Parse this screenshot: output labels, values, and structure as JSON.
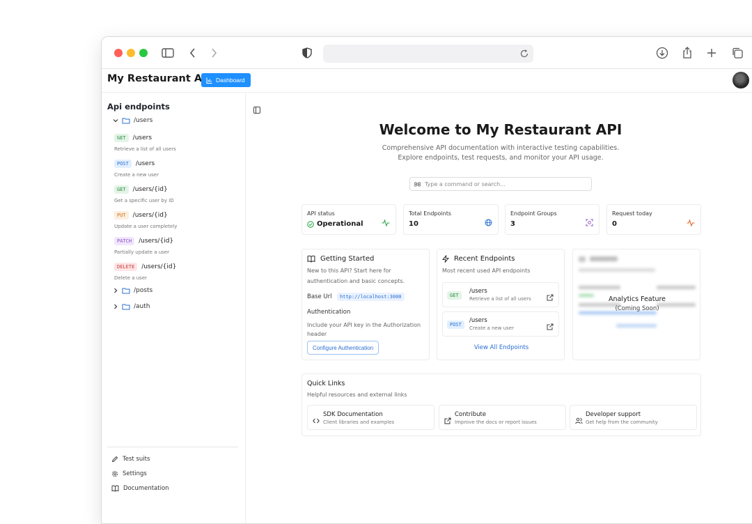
{
  "app": {
    "title": "My Restaurant API",
    "dashboard_label": "Dashboard"
  },
  "sidebar": {
    "title": "Api endpoints",
    "groups": [
      {
        "label": "/users",
        "expanded": true
      },
      {
        "label": "/posts",
        "expanded": false
      },
      {
        "label": "/auth",
        "expanded": false
      }
    ],
    "endpoints": [
      {
        "method": "GET",
        "path": "/users",
        "desc": "Retrieve a list of all users"
      },
      {
        "method": "POST",
        "path": "/users",
        "desc": "Create a new user"
      },
      {
        "method": "GET",
        "path": "/users/{id}",
        "desc": "Get a specific user by ID"
      },
      {
        "method": "PUT",
        "path": "/users/{id}",
        "desc": "Update a user completely"
      },
      {
        "method": "PATCH",
        "path": "/users/{id}",
        "desc": "Partially update a user"
      },
      {
        "method": "DELETE",
        "path": "/users/{id}",
        "desc": "Delete a user"
      }
    ],
    "footer": {
      "test_suits": "Test suits",
      "settings": "Settings",
      "documentation": "Documentation"
    }
  },
  "main": {
    "heading": "Welcome to My Restaurant API",
    "sub1": "Comprehensive API documentation with interactive testing capabilities.",
    "sub2": "Explore endpoints, test requests, and monitor your API usage.",
    "command_placeholder": "Type a command or search...",
    "stats": [
      {
        "label": "API status",
        "value": "Operational"
      },
      {
        "label": "Total Endpoints",
        "value": "10"
      },
      {
        "label": "Endpoint Groups",
        "value": "3"
      },
      {
        "label": "Request today",
        "value": "0"
      }
    ],
    "getting_started": {
      "title": "Getting Started",
      "line1": "New to this API? Start here for",
      "line2": "authentication and basic concepts.",
      "base_url_label": "Base Url",
      "base_url": "http://localhost:3000",
      "auth_label": "Authentication",
      "auth_line1": "Include your API key in the Authorization",
      "auth_line2": "header",
      "button": "Configure Authentication"
    },
    "recent": {
      "title": "Recent Endpoints",
      "sub": "Most recent used API endpoints",
      "items": [
        {
          "method": "GET",
          "path": "/users",
          "desc": "Retrieve a list of all users"
        },
        {
          "method": "POST",
          "path": "/users",
          "desc": "Create a new user"
        }
      ],
      "view_all": "View All Endpoints"
    },
    "analytics": {
      "title": "Analytics Feature",
      "sub": "(Coming Soon)"
    },
    "quick_links": {
      "title": "Quick Links",
      "sub": "Helpful resources and external links",
      "items": [
        {
          "title": "SDK Documentation",
          "desc": "Client libraries and examples"
        },
        {
          "title": "Contribute",
          "desc": "Improve the docs or report issues"
        },
        {
          "title": "Developer support",
          "desc": "Get help from the community"
        }
      ]
    }
  },
  "colors": {
    "accent": "#1e90ff",
    "success": "#2fa84f"
  }
}
